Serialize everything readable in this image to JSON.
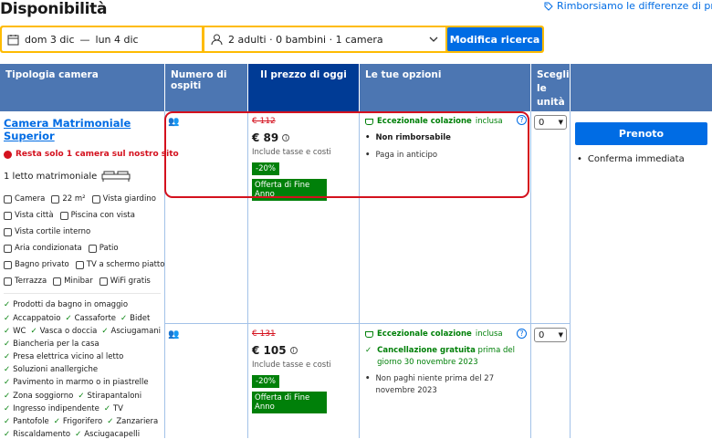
{
  "header": {
    "title": "Disponibilità",
    "refund_link": "Rimborsiamo le differenze di prezzo"
  },
  "search": {
    "dates_from": "dom 3 dic",
    "dates_sep": "—",
    "dates_to": "lun 4 dic",
    "guests": "2 adulti · 0 bambini · 1 camera",
    "button": "Modifica ricerca"
  },
  "table": {
    "headers": {
      "type": "Tipologia camera",
      "guests": "Numero di ospiti",
      "price": "Il prezzo di oggi",
      "options": "Le tue opzioni",
      "units": "Scegli le unità"
    },
    "room": {
      "name": "Camera Matrimoniale Superior",
      "scarcity": "Resta solo 1 camera sul nostro sito",
      "bed": "1 letto matrimoniale",
      "facilities": [
        [
          "Camera",
          "22 m²",
          "Vista giardino"
        ],
        [
          "Vista città",
          "Piscina con vista"
        ],
        [
          "Vista cortile interno"
        ],
        [
          "Aria condizionata",
          "Patio"
        ],
        [
          "Bagno privato",
          "TV a schermo piatto"
        ],
        [
          "Terrazza",
          "Minibar",
          "WiFi gratis"
        ]
      ],
      "amenities": [
        [
          "Prodotti da bagno in omaggio"
        ],
        [
          "Accappatoio",
          "Cassaforte",
          "Bidet"
        ],
        [
          "WC",
          "Vasca o doccia",
          "Asciugamani"
        ],
        [
          "Biancheria per la casa"
        ],
        [
          "Presa elettrica vicino al letto"
        ],
        [
          "Soluzioni anallergiche"
        ],
        [
          "Pavimento in marmo o in piastrelle"
        ],
        [
          "Zona soggiorno",
          "Stirapantaloni"
        ],
        [
          "Ingresso indipendente",
          "TV"
        ],
        [
          "Pantofole",
          "Frigorifero",
          "Zanzariera"
        ],
        [
          "Riscaldamento",
          "Asciugacapelli"
        ]
      ]
    },
    "offers": [
      {
        "old_price": "€ 112",
        "price": "€ 89",
        "tax": "Include tasse e costi",
        "discount": "-20%",
        "deal": "Offerta di Fine Anno",
        "breakfast_bold": "Eccezionale colazione",
        "breakfast_light": "inclusa",
        "line1_bold": "Non rimborsabile",
        "line2": "Paga in anticipo",
        "qty": "0",
        "book_button": "Prenoto",
        "confirm": "Conferma immediata"
      },
      {
        "old_price": "€ 131",
        "price": "€ 105",
        "tax": "Include tasse e costi",
        "discount": "-20%",
        "deal": "Offerta di Fine Anno",
        "breakfast_bold": "Eccezionale colazione",
        "breakfast_light": "inclusa",
        "cancel_bold": "Cancellazione gratuita",
        "cancel_rest": "prima del giorno 30 novembre 2023",
        "line2": "Non paghi niente prima del 27 novembre 2023",
        "qty": "0"
      }
    ]
  },
  "colors": {
    "accent": "#006ce4",
    "header_bg": "#4c76b2",
    "header_dark": "#003b95",
    "green": "#008009",
    "red": "#d4111e",
    "search_border": "#febb02"
  }
}
